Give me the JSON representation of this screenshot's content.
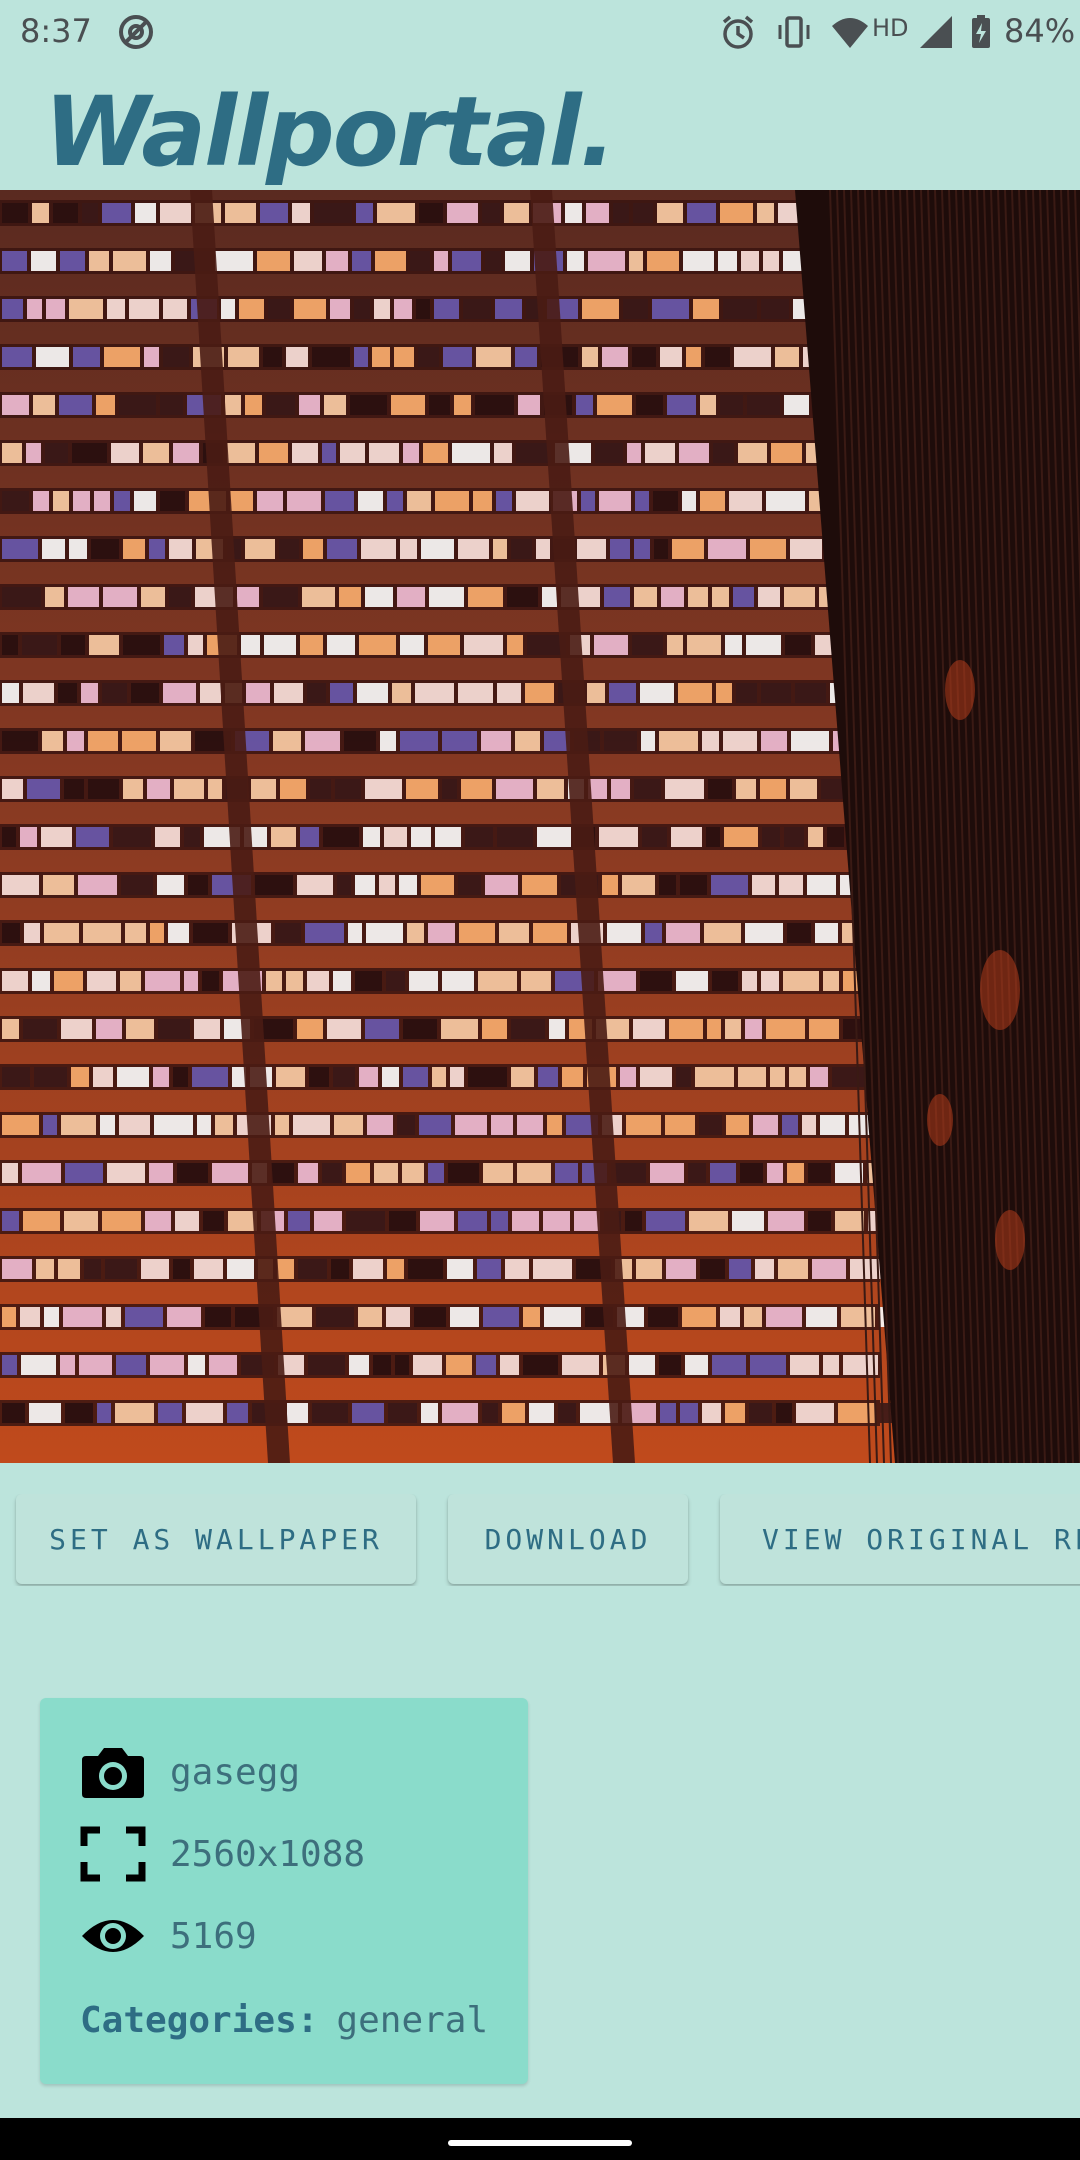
{
  "status_bar": {
    "time": "8:37",
    "network": "HD",
    "battery": "84%",
    "icons": [
      "do-not-disturb-icon",
      "alarm-icon",
      "vibrate-icon",
      "wifi-icon",
      "signal-icon",
      "battery-charging-icon"
    ]
  },
  "app": {
    "title": "Wallportal."
  },
  "actions": {
    "set_wallpaper": "SET AS WALLPAPER",
    "download": "DOWNLOAD",
    "view_original": "VIEW ORIGINAL RE"
  },
  "info": {
    "author": "gasegg",
    "resolution": "2560x1088",
    "views": "5169",
    "categories_label": "Categories:",
    "categories_value": "general"
  },
  "colors": {
    "background": "#bce4dc",
    "card": "#8adccb",
    "accent": "#2e6d84"
  }
}
